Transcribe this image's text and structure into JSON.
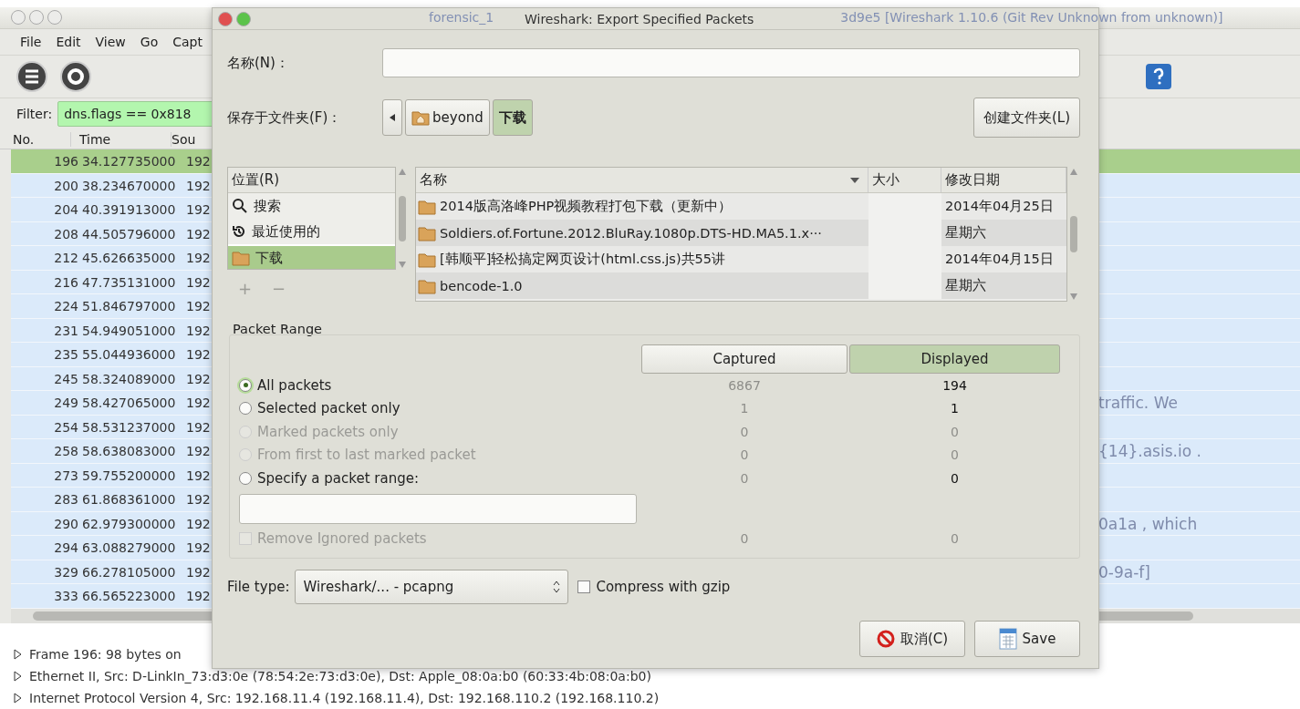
{
  "main_window": {
    "title_parts": [
      "forensic_1",
      "3d9e5  [Wireshark 1.10.6  (Git Rev Unknown from unknown)]"
    ],
    "menu": [
      "File",
      "Edit",
      "View",
      "Go",
      "Capt"
    ],
    "filter": {
      "label": "Filter:",
      "value": "dns.flags == 0x818"
    },
    "packet_list": {
      "columns": [
        "No.",
        "Time",
        "Sou"
      ],
      "rows": [
        {
          "no": "196",
          "time": "34.127735000",
          "source": "192",
          "selected": true
        },
        {
          "no": "200",
          "time": "38.234670000",
          "source": "192",
          "selected": false
        },
        {
          "no": "204",
          "time": "40.391913000",
          "source": "192",
          "selected": false
        },
        {
          "no": "208",
          "time": "44.505796000",
          "source": "192",
          "selected": false
        },
        {
          "no": "212",
          "time": "45.626635000",
          "source": "192",
          "selected": false
        },
        {
          "no": "216",
          "time": "47.735131000",
          "source": "192",
          "selected": false
        },
        {
          "no": "224",
          "time": "51.846797000",
          "source": "192",
          "selected": false
        },
        {
          "no": "231",
          "time": "54.949051000",
          "source": "192",
          "selected": false
        },
        {
          "no": "235",
          "time": "55.044936000",
          "source": "192",
          "selected": false
        },
        {
          "no": "245",
          "time": "58.324089000",
          "source": "192",
          "selected": false
        },
        {
          "no": "249",
          "time": "58.427065000",
          "source": "192",
          "selected": false,
          "faded_text": "traffic. We"
        },
        {
          "no": "254",
          "time": "58.531237000",
          "source": "192",
          "selected": false
        },
        {
          "no": "258",
          "time": "58.638083000",
          "source": "192",
          "selected": false,
          "faded_text": "{14}.asis.io ."
        },
        {
          "no": "273",
          "time": "59.755200000",
          "source": "192",
          "selected": false
        },
        {
          "no": "283",
          "time": "61.868361000",
          "source": "192",
          "selected": false
        },
        {
          "no": "290",
          "time": "62.979300000",
          "source": "192",
          "selected": false,
          "faded_text": "0a1a , which"
        },
        {
          "no": "294",
          "time": "63.088279000",
          "source": "192",
          "selected": false
        },
        {
          "no": "329",
          "time": "66.278105000",
          "source": "192",
          "selected": false,
          "faded_text": "0-9a-f]"
        },
        {
          "no": "333",
          "time": "66.565223000",
          "source": "192",
          "selected": false
        }
      ]
    },
    "details": [
      {
        "text": "Frame 196: 98 bytes on",
        "expanded": false
      },
      {
        "text": "Ethernet II, Src: D-LinkIn_73:d3:0e (78:54:2e:73:d3:0e), Dst: Apple_08:0a:b0 (60:33:4b:08:0a:b0)",
        "expanded": false
      },
      {
        "text": "Internet Protocol Version 4, Src: 192.168.11.4 (192.168.11.4), Dst: 192.168.110.2 (192.168.110.2)",
        "expanded": false
      }
    ]
  },
  "dialog": {
    "title": "Wireshark: Export Specified Packets",
    "name": {
      "label": "名称(N)："
    },
    "save_in": {
      "label": "保存于文件夹(F)：",
      "path": [
        {
          "label": "beyond",
          "kind": "home",
          "selected": false
        },
        {
          "label": "下载",
          "kind": "folder",
          "selected": true
        }
      ],
      "create_folder": "创建文件夹(L)"
    },
    "places": {
      "header": "位置(R)",
      "items": [
        {
          "label": "搜索",
          "kind": "search",
          "selected": false
        },
        {
          "label": "最近使用的",
          "kind": "recent",
          "selected": false
        },
        {
          "label": "下载",
          "kind": "folder",
          "selected": true
        }
      ],
      "add": "+",
      "remove": "−"
    },
    "files": {
      "columns": [
        "名称",
        "大小",
        "修改日期"
      ],
      "rows": [
        {
          "name": "2014版高洛峰PHP视频教程打包下载（更新中）",
          "modified": "2014年04月25日"
        },
        {
          "name": "Soldiers.of.Fortune.2012.BluRay.1080p.DTS-HD.MA5.1.x···",
          "modified": "星期六"
        },
        {
          "name": "[韩顺平]轻松搞定网页设计(html.css.js)共55讲",
          "modified": "2014年04月15日"
        },
        {
          "name": "bencode-1.0",
          "modified": "星期六"
        }
      ]
    },
    "packet_range": {
      "title": "Packet Range",
      "columns": [
        {
          "label": "Captured",
          "selected": false
        },
        {
          "label": "Displayed",
          "selected": true
        }
      ],
      "rows": [
        {
          "kind": "radio",
          "label": "All packets",
          "selected": true,
          "disabled": false,
          "captured": "6867",
          "displayed": "194"
        },
        {
          "kind": "radio",
          "label": "Selected packet only",
          "selected": false,
          "disabled": false,
          "captured": "1",
          "displayed": "1"
        },
        {
          "kind": "radio",
          "label": "Marked packets only",
          "selected": false,
          "disabled": true,
          "captured": "0",
          "displayed": "0"
        },
        {
          "kind": "radio",
          "label": "From first to last marked packet",
          "selected": false,
          "disabled": true,
          "captured": "0",
          "displayed": "0"
        },
        {
          "kind": "radio",
          "label": "Specify a packet range:",
          "selected": false,
          "disabled": false,
          "captured": "0",
          "displayed": "0"
        },
        {
          "kind": "field"
        },
        {
          "kind": "checkbox",
          "label": "Remove Ignored packets",
          "checked": false,
          "disabled": true,
          "captured": "0",
          "displayed": "0"
        }
      ]
    },
    "file_type": {
      "label": "File type:",
      "value": "Wireshark/... - pcapng"
    },
    "compress": {
      "label": "Compress with gzip",
      "checked": false
    },
    "buttons": [
      {
        "label": "取消(C)",
        "kind": "cancel"
      },
      {
        "label": "Save",
        "kind": "save"
      }
    ]
  }
}
